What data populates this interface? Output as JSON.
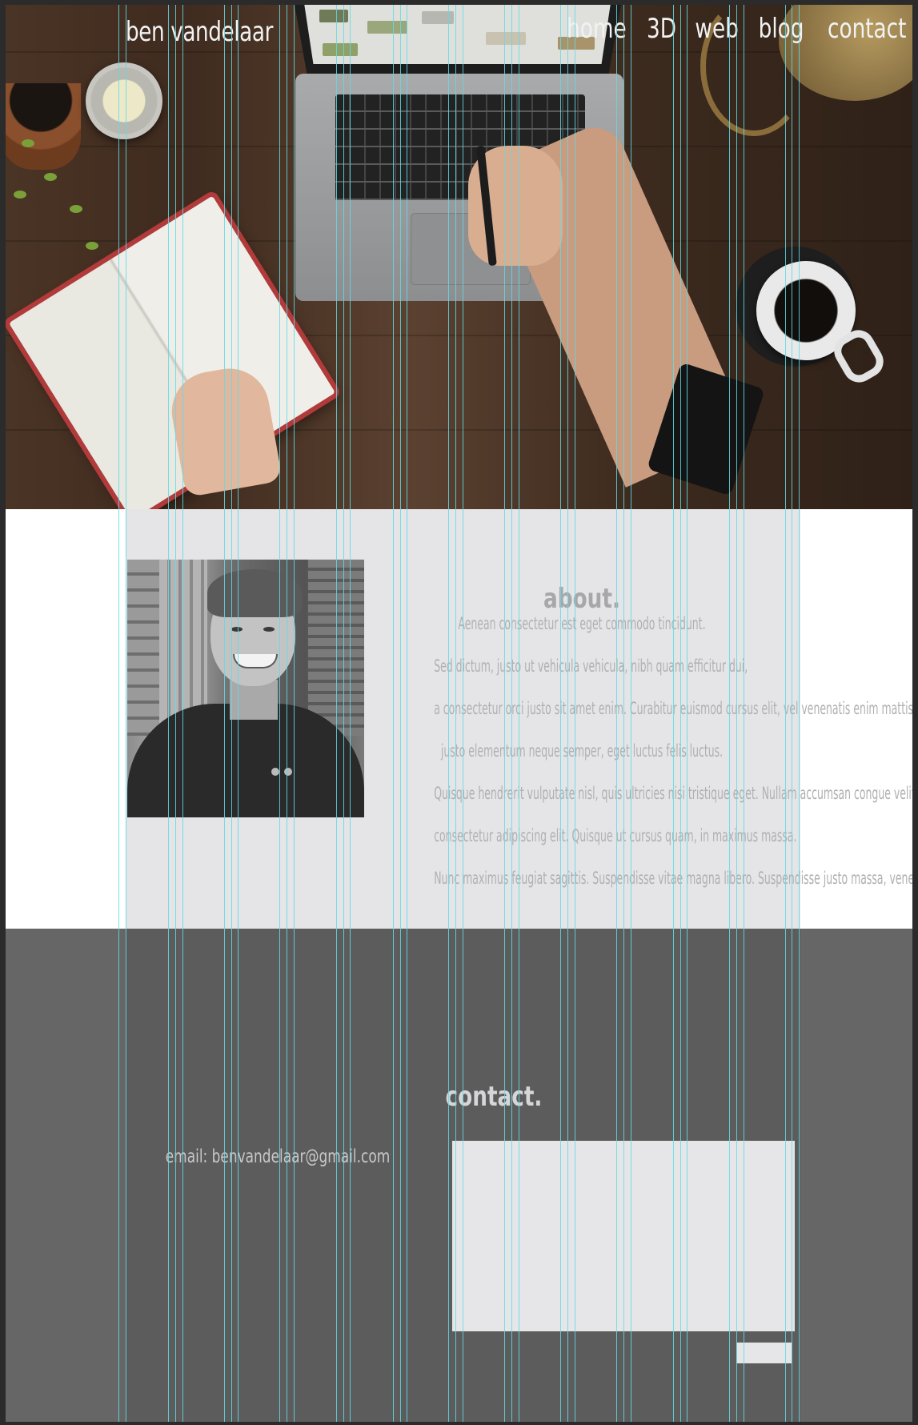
{
  "header": {
    "logo": "ben vandelaar",
    "nav": [
      "home",
      "3D",
      "web",
      "blog",
      "contact"
    ]
  },
  "about": {
    "title": "about.",
    "lines": [
      "Aenean consectetur est eget commodo tincidunt.",
      "Sed dictum, justo ut vehicula vehicula, nibh quam efficitur dui,",
      "a consectetur orci justo sit amet enim. Curabitur euismod cursus elit, vel venenatis enim mattis non. Maecenas pellentesque",
      "justo elementum neque semper, eget luctus felis luctus.",
      "Quisque hendrerit vulputate nisl, quis ultricies nisi tristique eget. Nullam accumsan congue velit. Lorem ipsum dolor sit amet,",
      "consectetur adipiscing elit. Quisque ut cursus quam, in maximus massa.",
      "Nunc maximus feugiat sagittis. Suspendisse vitae magna libero. Suspendisse justo massa, venenatis in dictum in, malesuada sit amet tellus."
    ]
  },
  "contact": {
    "title": "contact.",
    "email": "email: benvandelaar@gmail.com"
  },
  "colors": {
    "guide": "#5fdce6",
    "panel_light": "#e5e4e6",
    "panel_dark": "#5c5c5c"
  }
}
